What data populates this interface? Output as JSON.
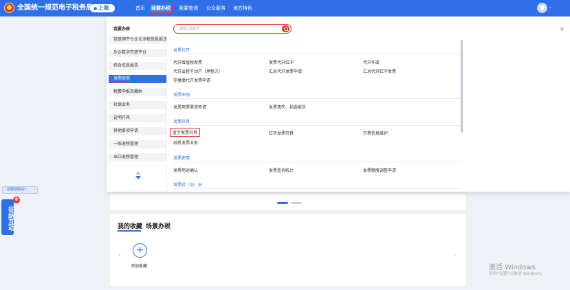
{
  "header": {
    "site_title": "全国统一规范电子税务局",
    "city": "上海",
    "nav": [
      "首页",
      "我要办税",
      "我要查询",
      "公众服务",
      "地方特色"
    ]
  },
  "menu": {
    "panel_title": "我要办税",
    "categories": [
      "互联网平台企业涉税信息报送",
      "乐企数字开放平台",
      "综合信息报告",
      "发票使用",
      "税费申报及缴纳",
      "社保业务",
      "证明开具",
      "其他事项申请",
      "一般退税管理",
      "出口退税管理"
    ],
    "search_placeholder": "请输入关键词",
    "sections": [
      {
        "title": "发票代开",
        "links": [
          "代开增值税发票",
          "发票代开红冲",
          "代开作废",
          "代开出租不动产（承租方）",
          "汇总代开发票申请",
          "汇总代开红字发票",
          "存量缴代开发票申请"
        ]
      },
      {
        "title": "发票申领",
        "links": [
          "发票用票需求申请",
          "发票遗失、损毁报告"
        ]
      },
      {
        "title": "发票开具",
        "links": [
          "蓝字发票开具",
          "红字发票开具",
          "开票信息维护",
          "纸质发票业务"
        ]
      },
      {
        "title": "发票使用",
        "links": [
          "发票用途确认",
          "发票查询统计",
          "发票额度调整申请"
        ]
      },
      {
        "title": "发票验（交）旧"
      }
    ]
  },
  "background": {
    "tabs": [
      "我的收藏",
      "场景办税"
    ],
    "add_label": "添加收藏",
    "windows_line1": "激活 Windows",
    "windows_line2": "转到\"设置\"以激活 Windows。"
  },
  "side": {
    "mini_label": "需要帮助吗?",
    "vertical_tab": "征纳互动",
    "badge": "8"
  },
  "colors": {
    "primary": "#2f6fe8",
    "highlight_red": "#e53935"
  }
}
